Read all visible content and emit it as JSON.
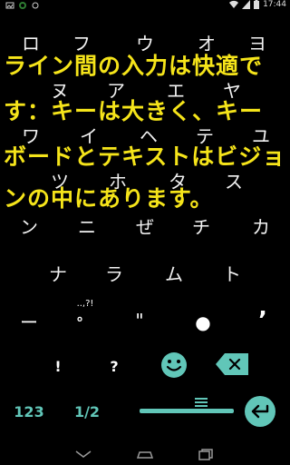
{
  "status_bar": {
    "time": "17:44",
    "left_icons": [
      "image-icon",
      "android-icon",
      "sync-icon"
    ],
    "right_icons": [
      "wifi-icon",
      "signal-icon",
      "battery-icon"
    ]
  },
  "kana_rows": [
    [
      "ロ",
      "フ",
      "ウ",
      "オ",
      "ヨ"
    ],
    [
      "ヌ",
      "ア",
      "エ",
      "ヤ"
    ],
    [
      "ワ",
      "イ",
      "ヘ",
      "テ",
      "ユ"
    ],
    [
      "ツ",
      "ホ",
      "タ",
      "ス"
    ],
    [
      "ン",
      "ニ",
      "ぜ",
      "チ",
      "カ"
    ],
    [
      "ナ",
      "ラ",
      "ム",
      "ト"
    ]
  ],
  "message_lines": [
    "ライン間の入力は快適で",
    "す：キーは大きく、キー",
    "ボードとテキストはビジョ",
    "ンの中にあります。"
  ],
  "keyboard": {
    "row_punct": [
      "ー",
      "°",
      "..,?!",
      "\"",
      "●",
      "’"
    ],
    "row_symbols": [
      "!",
      "?"
    ],
    "mode_label": "123",
    "page_label": "1/2"
  },
  "colors": {
    "accent": "#61c6b8",
    "message": "#f5e41a",
    "background": "#000000"
  }
}
